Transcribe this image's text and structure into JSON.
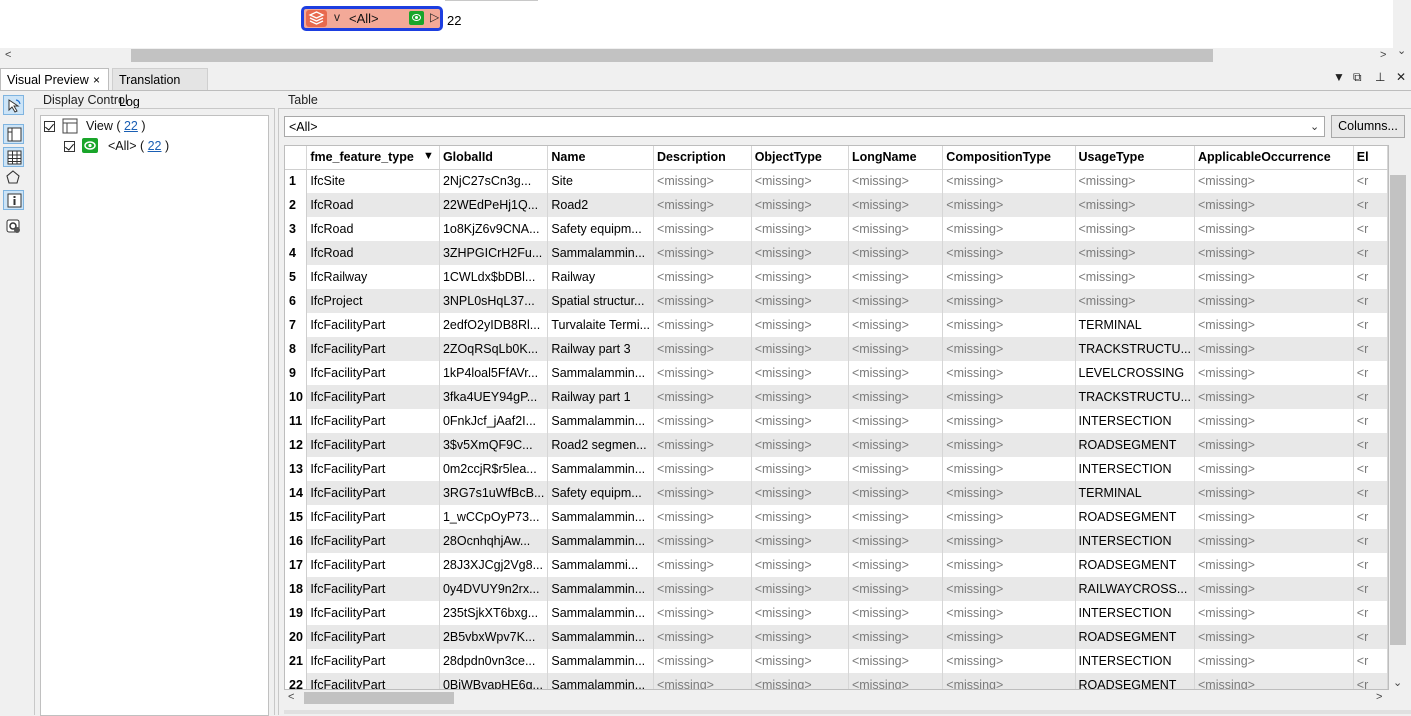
{
  "canvas": {
    "node": {
      "label": "<All>",
      "count": "22"
    }
  },
  "tabs": [
    {
      "label": "Visual Preview",
      "close": "×"
    },
    {
      "label": "Translation Log"
    }
  ],
  "display_control": {
    "title": "Display Control",
    "view": {
      "label": "View",
      "count": "22"
    },
    "all": {
      "label": "<All>",
      "count": "22"
    }
  },
  "table": {
    "title": "Table",
    "filter_value": "<All>",
    "columns_button": "Columns...",
    "columns": [
      "fme_feature_type",
      "GlobalId",
      "Name",
      "Description",
      "ObjectType",
      "LongName",
      "CompositionType",
      "UsageType",
      "ApplicableOccurrence",
      "El"
    ],
    "rows": [
      [
        "1",
        "IfcSite",
        "2NjC27sCn3g...",
        "Site",
        "<missing>",
        "<missing>",
        "<missing>",
        "<missing>",
        "<missing>",
        "<missing>",
        "<r"
      ],
      [
        "2",
        "IfcRoad",
        "22WEdPeHj1Q...",
        "Road2",
        "<missing>",
        "<missing>",
        "<missing>",
        "<missing>",
        "<missing>",
        "<missing>",
        "<r"
      ],
      [
        "3",
        "IfcRoad",
        "1o8KjZ6v9CNA...",
        "Safety equipm...",
        "<missing>",
        "<missing>",
        "<missing>",
        "<missing>",
        "<missing>",
        "<missing>",
        "<r"
      ],
      [
        "4",
        "IfcRoad",
        "3ZHPGICrH2Fu...",
        "Sammalammin...",
        "<missing>",
        "<missing>",
        "<missing>",
        "<missing>",
        "<missing>",
        "<missing>",
        "<r"
      ],
      [
        "5",
        "IfcRailway",
        "1CWLdx$bDBl...",
        "Railway",
        "<missing>",
        "<missing>",
        "<missing>",
        "<missing>",
        "<missing>",
        "<missing>",
        "<r"
      ],
      [
        "6",
        "IfcProject",
        "3NPL0sHqL37...",
        "Spatial structur...",
        "<missing>",
        "<missing>",
        "<missing>",
        "<missing>",
        "<missing>",
        "<missing>",
        "<r"
      ],
      [
        "7",
        "IfcFacilityPart",
        "2edfO2yIDB8Rl...",
        "Turvalaite Termi...",
        "<missing>",
        "<missing>",
        "<missing>",
        "<missing>",
        "TERMINAL",
        "<missing>",
        "<r"
      ],
      [
        "8",
        "IfcFacilityPart",
        "2ZOqRSqLb0K...",
        "Railway part 3",
        "<missing>",
        "<missing>",
        "<missing>",
        "<missing>",
        "TRACKSTRUCTU...",
        "<missing>",
        "<r"
      ],
      [
        "9",
        "IfcFacilityPart",
        "1kP4loal5FfAVr...",
        "Sammalammin...",
        "<missing>",
        "<missing>",
        "<missing>",
        "<missing>",
        "LEVELCROSSING",
        "<missing>",
        "<r"
      ],
      [
        "10",
        "IfcFacilityPart",
        "3fka4UEY94gP...",
        "Railway part 1",
        "<missing>",
        "<missing>",
        "<missing>",
        "<missing>",
        "TRACKSTRUCTU...",
        "<missing>",
        "<r"
      ],
      [
        "11",
        "IfcFacilityPart",
        "0FnkJcf_jAaf2I...",
        "Sammalammin...",
        "<missing>",
        "<missing>",
        "<missing>",
        "<missing>",
        "INTERSECTION",
        "<missing>",
        "<r"
      ],
      [
        "12",
        "IfcFacilityPart",
        "3$v5XmQF9C...",
        "Road2 segmen...",
        "<missing>",
        "<missing>",
        "<missing>",
        "<missing>",
        "ROADSEGMENT",
        "<missing>",
        "<r"
      ],
      [
        "13",
        "IfcFacilityPart",
        "0m2ccjR$r5lea...",
        "Sammalammin...",
        "<missing>",
        "<missing>",
        "<missing>",
        "<missing>",
        "INTERSECTION",
        "<missing>",
        "<r"
      ],
      [
        "14",
        "IfcFacilityPart",
        "3RG7s1uWfBcB...",
        "Safety equipm...",
        "<missing>",
        "<missing>",
        "<missing>",
        "<missing>",
        "TERMINAL",
        "<missing>",
        "<r"
      ],
      [
        "15",
        "IfcFacilityPart",
        "1_wCCpOyP73...",
        "Sammalammin...",
        "<missing>",
        "<missing>",
        "<missing>",
        "<missing>",
        "ROADSEGMENT",
        "<missing>",
        "<r"
      ],
      [
        "16",
        "IfcFacilityPart",
        "28OcnhqhjAw...",
        "Sammalammin...",
        "<missing>",
        "<missing>",
        "<missing>",
        "<missing>",
        "INTERSECTION",
        "<missing>",
        "<r"
      ],
      [
        "17",
        "IfcFacilityPart",
        "28J3XJCgj2Vg8...",
        "Sammalammi...",
        "<missing>",
        "<missing>",
        "<missing>",
        "<missing>",
        "ROADSEGMENT",
        "<missing>",
        "<r"
      ],
      [
        "18",
        "IfcFacilityPart",
        "0y4DVUY9n2rx...",
        "Sammalammin...",
        "<missing>",
        "<missing>",
        "<missing>",
        "<missing>",
        "RAILWAYCROSS...",
        "<missing>",
        "<r"
      ],
      [
        "19",
        "IfcFacilityPart",
        "235tSjkXT6bxg...",
        "Sammalammin...",
        "<missing>",
        "<missing>",
        "<missing>",
        "<missing>",
        "INTERSECTION",
        "<missing>",
        "<r"
      ],
      [
        "20",
        "IfcFacilityPart",
        "2B5vbxWpv7K...",
        "Sammalammin...",
        "<missing>",
        "<missing>",
        "<missing>",
        "<missing>",
        "ROADSEGMENT",
        "<missing>",
        "<r"
      ],
      [
        "21",
        "IfcFacilityPart",
        "28dpdn0vn3ce...",
        "Sammalammin...",
        "<missing>",
        "<missing>",
        "<missing>",
        "<missing>",
        "INTERSECTION",
        "<missing>",
        "<r"
      ],
      [
        "22",
        "IfcFacilityPart",
        "0BiWBvapHE6q...",
        "Sammalammin...",
        "<missing>",
        "<missing>",
        "<missing>",
        "<missing>",
        "ROADSEGMENT",
        "<missing>",
        "<r"
      ]
    ]
  }
}
